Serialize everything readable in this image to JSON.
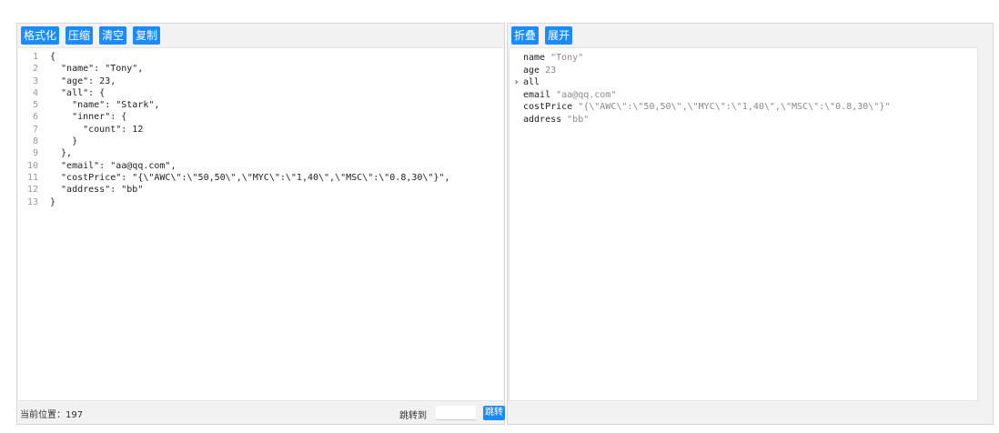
{
  "left": {
    "buttons": {
      "format": "格式化",
      "compress": "压缩",
      "clear": "清空",
      "copy": "复制"
    },
    "code_lines": [
      {
        "num": "1",
        "text": "{"
      },
      {
        "num": "2",
        "text": "  \"name\": \"Tony\","
      },
      {
        "num": "3",
        "text": "  \"age\": 23,"
      },
      {
        "num": "4",
        "text": "  \"all\": {"
      },
      {
        "num": "5",
        "text": "    \"name\": \"Stark\","
      },
      {
        "num": "6",
        "text": "    \"inner\": {"
      },
      {
        "num": "7",
        "text": "      \"count\": 12"
      },
      {
        "num": "8",
        "text": "    }"
      },
      {
        "num": "9",
        "text": "  },"
      },
      {
        "num": "10",
        "text": "  \"email\": \"aa@qq.com\","
      },
      {
        "num": "11",
        "text": "  \"costPrice\": \"{\\\"AWC\\\":\\\"50,50\\\",\\\"MYC\\\":\\\"1,40\\\",\\\"MSC\\\":\\\"0.8,30\\\"}\","
      },
      {
        "num": "12",
        "text": "  \"address\": \"bb\""
      },
      {
        "num": "13",
        "text": "}"
      }
    ],
    "status": {
      "position_text": "当前位置：197",
      "jump_label": "跳转到",
      "jump_value": "",
      "jump_button": "跳转"
    }
  },
  "right": {
    "buttons": {
      "collapse": "折叠",
      "expand": "展开"
    },
    "tree_rows": [
      {
        "arrow": "",
        "key": "name",
        "value": "\"Tony\""
      },
      {
        "arrow": "",
        "key": "age",
        "value": "23"
      },
      {
        "arrow": "›",
        "key": "all",
        "value": ""
      },
      {
        "arrow": "",
        "key": "email",
        "value": "\"aa@qq.com\""
      },
      {
        "arrow": "",
        "key": "costPrice",
        "value": "\"{\\\"AWC\\\":\\\"50,50\\\",\\\"MYC\\\":\\\"1,40\\\",\\\"MSC\\\":\\\"0.8,30\\\"}\""
      },
      {
        "arrow": "",
        "key": "address",
        "value": "\"bb\""
      }
    ]
  },
  "colors": {
    "button_blue": "#1a8cff",
    "panel_bg": "#f2f2f2",
    "value_gray": "#8a8a8a"
  },
  "icons": {
    "expand_arrow": "chevron-right-icon"
  }
}
